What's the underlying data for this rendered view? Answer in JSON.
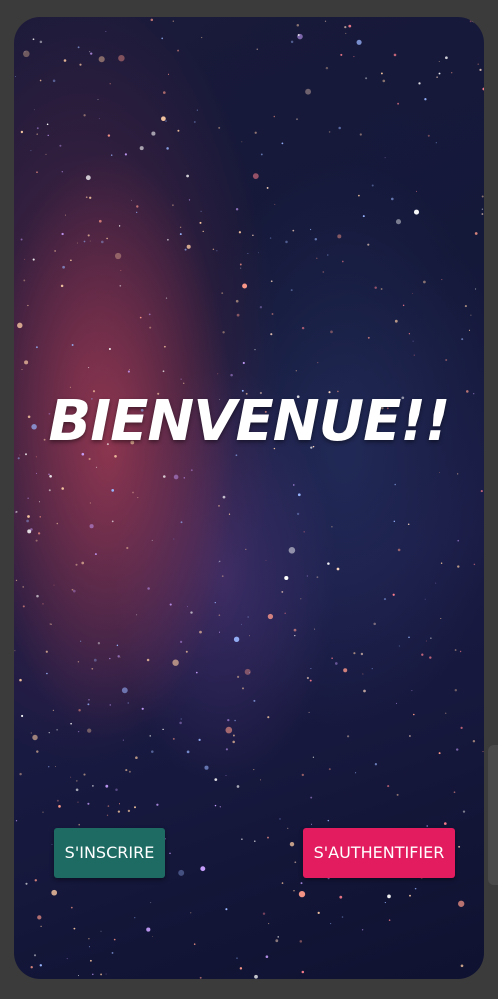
{
  "screen": {
    "title": "BIENVENUE!!",
    "background": "starry-galaxy-image"
  },
  "buttons": {
    "register_label": "S'INSCRIRE",
    "login_label": "S'AUTHENTIFIER"
  },
  "colors": {
    "register_bg": "#1e6b63",
    "login_bg": "#e31c5f",
    "title_text": "#ffffff"
  }
}
